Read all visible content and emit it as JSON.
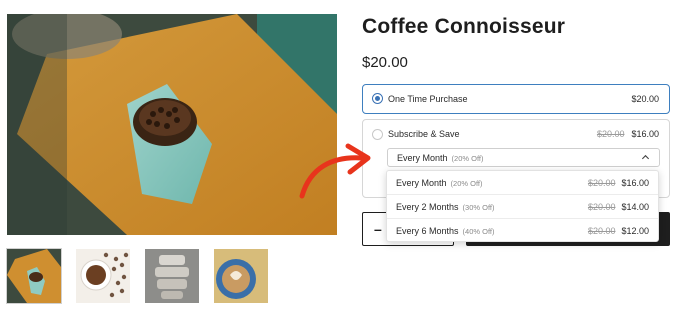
{
  "product": {
    "title": "Coffee Connoisseur",
    "price": "$20.00"
  },
  "purchase_options": {
    "one_time": {
      "label": "One Time Purchase",
      "price": "$20.00",
      "selected": true
    },
    "subscribe": {
      "label": "Subscribe & Save",
      "original_price": "$20.00",
      "price": "$16.00",
      "selected": false,
      "frequency_select": {
        "value": "Every Month",
        "discount": "(20% Off)"
      }
    }
  },
  "frequency_options": [
    {
      "label": "Every Month",
      "discount": "(20% Off)",
      "original_price": "$20.00",
      "price": "$16.00"
    },
    {
      "label": "Every 2 Months",
      "discount": "(30% Off)",
      "original_price": "$20.00",
      "price": "$14.00"
    },
    {
      "label": "Every 6 Months",
      "discount": "(40% Off)",
      "original_price": "$20.00",
      "price": "$12.00"
    }
  ],
  "quantity": {
    "decrement": "–"
  },
  "colors": {
    "accent_blue": "#3a72b5",
    "arrow_red": "#e8341c",
    "button_dark": "#1e1e1e"
  }
}
